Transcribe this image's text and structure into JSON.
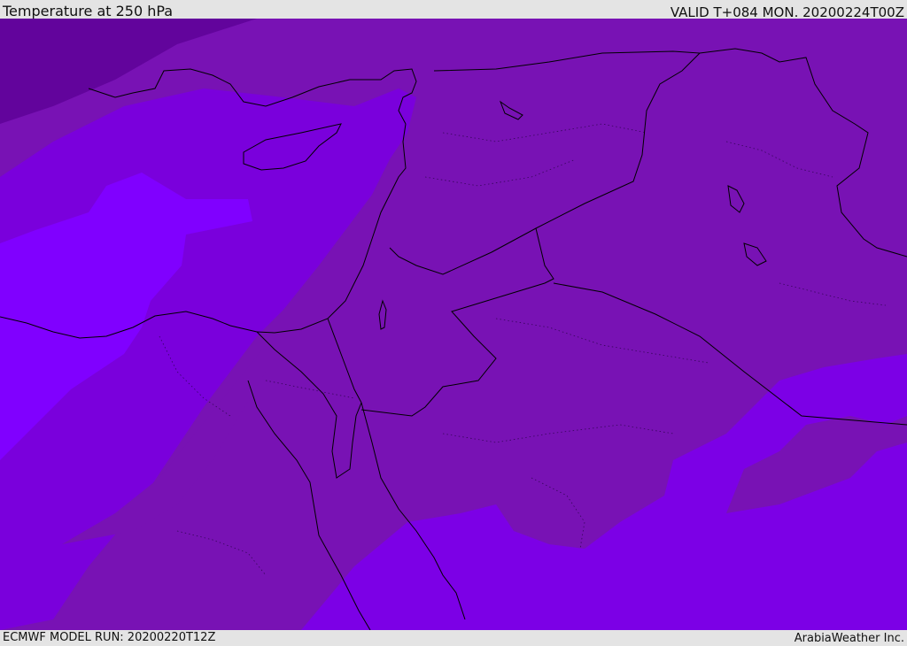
{
  "header": {
    "title": "Temperature at 250 hPa",
    "valid": "VALID T+084 MON. 20200224T00Z"
  },
  "footer": {
    "model_run": "ECMWF MODEL RUN: 20200220T12Z",
    "credit": "ArabiaWeather Inc."
  },
  "colors": {
    "band_coldest": "#62049c",
    "band_cold": "#7812b4",
    "band_mid": "#7a00dc",
    "band_warm": "#7c00f0",
    "band_warmest": "#8000ff",
    "coastline": "#000000",
    "header_bg": "#e4e4e4"
  }
}
